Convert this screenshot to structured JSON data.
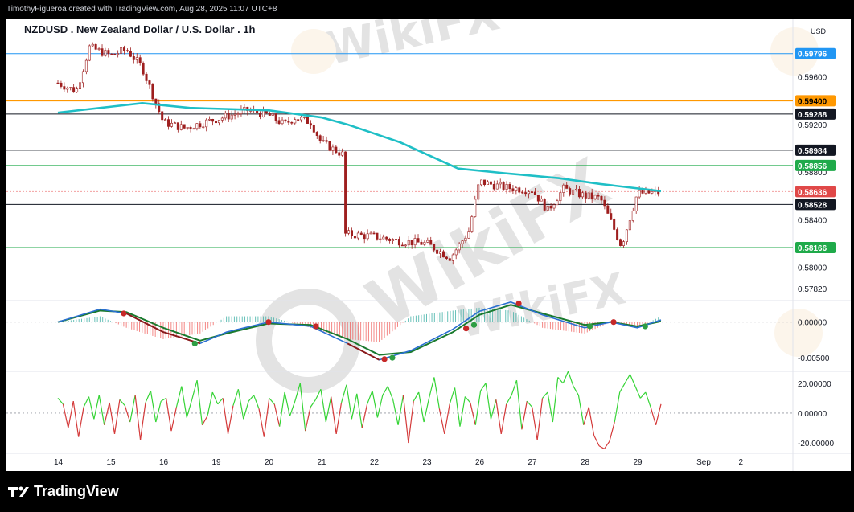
{
  "credit": "TimothyFigueroa created with TradingView.com, Aug 28, 2025 11:07 UTC+8",
  "title": "NZDUSD . New Zealand Dollar / U.S. Dollar . 1h",
  "currency": "USD",
  "brand": "TradingView",
  "watermark": "WikiFX",
  "colors": {
    "candle": "#9e1e1e",
    "ma": "#1fbfc6",
    "macd_line": "#2a6fd1",
    "signal_line": "#1a7a2e",
    "rsi_up": "#36d436",
    "rsi_down": "#d43a3a",
    "blue_level": "#2196f3",
    "orange_level": "#ff9800",
    "green_level": "#1faa4a",
    "red_price": "#e04848"
  },
  "chart_data": [
    {
      "type": "candlestick",
      "name": "NZDUSD 1h",
      "x_labels": [
        "14",
        "15",
        "16",
        "19",
        "20",
        "21",
        "22",
        "23",
        "26",
        "27",
        "28",
        "29",
        "Sep",
        "2"
      ],
      "y_ticks": [
        "0.59600",
        "0.59200",
        "0.58800",
        "0.58400",
        "0.58000",
        "0.57820"
      ],
      "ylim": [
        0.5772,
        0.5999
      ],
      "price_path": [
        {
          "x": 0.0,
          "y": 0.5955
        },
        {
          "x": 0.35,
          "y": 0.5948
        },
        {
          "x": 0.6,
          "y": 0.5985
        },
        {
          "x": 1.0,
          "y": 0.5978
        },
        {
          "x": 1.3,
          "y": 0.5983
        },
        {
          "x": 1.6,
          "y": 0.5968
        },
        {
          "x": 2.0,
          "y": 0.5922
        },
        {
          "x": 2.4,
          "y": 0.5917
        },
        {
          "x": 2.8,
          "y": 0.5922
        },
        {
          "x": 3.3,
          "y": 0.5928
        },
        {
          "x": 3.6,
          "y": 0.5932
        },
        {
          "x": 4.0,
          "y": 0.5928
        },
        {
          "x": 4.3,
          "y": 0.592
        },
        {
          "x": 4.5,
          "y": 0.5926
        },
        {
          "x": 4.8,
          "y": 0.5922
        },
        {
          "x": 5.0,
          "y": 0.5905
        },
        {
          "x": 5.4,
          "y": 0.5895
        },
        {
          "x": 5.45,
          "y": 0.5828
        },
        {
          "x": 6.0,
          "y": 0.5826
        },
        {
          "x": 6.5,
          "y": 0.5822
        },
        {
          "x": 7.0,
          "y": 0.582
        },
        {
          "x": 7.45,
          "y": 0.5808
        },
        {
          "x": 7.8,
          "y": 0.583
        },
        {
          "x": 8.0,
          "y": 0.5872
        },
        {
          "x": 8.5,
          "y": 0.5867
        },
        {
          "x": 9.0,
          "y": 0.5865
        },
        {
          "x": 9.3,
          "y": 0.5848
        },
        {
          "x": 9.6,
          "y": 0.5866
        },
        {
          "x": 10.0,
          "y": 0.586
        },
        {
          "x": 10.3,
          "y": 0.5858
        },
        {
          "x": 10.7,
          "y": 0.5818
        },
        {
          "x": 11.0,
          "y": 0.5862
        },
        {
          "x": 11.45,
          "y": 0.5863
        }
      ],
      "moving_average": [
        {
          "x": 0.0,
          "y": 0.593
        },
        {
          "x": 1.0,
          "y": 0.5935
        },
        {
          "x": 1.6,
          "y": 0.5938
        },
        {
          "x": 2.5,
          "y": 0.5934
        },
        {
          "x": 4.0,
          "y": 0.5932
        },
        {
          "x": 5.0,
          "y": 0.5926
        },
        {
          "x": 5.5,
          "y": 0.592
        },
        {
          "x": 6.5,
          "y": 0.5905
        },
        {
          "x": 7.6,
          "y": 0.5883
        },
        {
          "x": 8.5,
          "y": 0.5879
        },
        {
          "x": 9.5,
          "y": 0.5875
        },
        {
          "x": 10.3,
          "y": 0.587
        },
        {
          "x": 11.45,
          "y": 0.5864
        }
      ],
      "levels": [
        {
          "price": 0.59796,
          "label": "0.59796",
          "style": "blue"
        },
        {
          "price": 0.594,
          "label": "0.59400",
          "style": "orange"
        },
        {
          "price": 0.59288,
          "label": "0.59288",
          "style": "black"
        },
        {
          "price": 0.58984,
          "label": "0.58984",
          "style": "black"
        },
        {
          "price": 0.58856,
          "label": "0.58856",
          "style": "green"
        },
        {
          "price": 0.58636,
          "label": "0.58636",
          "style": "red"
        },
        {
          "price": 0.58528,
          "label": "0.58528",
          "style": "black"
        },
        {
          "price": 0.58166,
          "label": "0.58166",
          "style": "green"
        }
      ]
    },
    {
      "type": "line",
      "name": "MACD",
      "y_ticks": [
        "0.00000",
        "-0.00500"
      ],
      "ylim": [
        -0.0069,
        0.003
      ],
      "macd": [
        {
          "x": 0.0,
          "y": 0.0
        },
        {
          "x": 0.8,
          "y": 0.0018
        },
        {
          "x": 1.3,
          "y": 0.0012
        },
        {
          "x": 2.0,
          "y": -0.0014
        },
        {
          "x": 2.7,
          "y": -0.003
        },
        {
          "x": 3.2,
          "y": -0.0014
        },
        {
          "x": 4.0,
          "y": 0.0
        },
        {
          "x": 4.8,
          "y": -0.0006
        },
        {
          "x": 5.5,
          "y": -0.003
        },
        {
          "x": 6.1,
          "y": -0.0053
        },
        {
          "x": 6.7,
          "y": -0.004
        },
        {
          "x": 7.5,
          "y": -0.001
        },
        {
          "x": 8.0,
          "y": 0.0015
        },
        {
          "x": 8.6,
          "y": 0.0028
        },
        {
          "x": 9.2,
          "y": 0.001
        },
        {
          "x": 10.0,
          "y": -0.0008
        },
        {
          "x": 10.5,
          "y": 0.0
        },
        {
          "x": 11.0,
          "y": -0.0008
        },
        {
          "x": 11.45,
          "y": 0.0003
        }
      ],
      "signal": [
        {
          "x": 0.0,
          "y": 0.0
        },
        {
          "x": 0.8,
          "y": 0.0016
        },
        {
          "x": 1.3,
          "y": 0.0014
        },
        {
          "x": 2.0,
          "y": -0.0008
        },
        {
          "x": 2.7,
          "y": -0.0026
        },
        {
          "x": 3.2,
          "y": -0.0016
        },
        {
          "x": 4.0,
          "y": -0.0002
        },
        {
          "x": 4.8,
          "y": -0.0004
        },
        {
          "x": 5.5,
          "y": -0.0024
        },
        {
          "x": 6.1,
          "y": -0.0046
        },
        {
          "x": 6.7,
          "y": -0.0042
        },
        {
          "x": 7.5,
          "y": -0.0014
        },
        {
          "x": 8.0,
          "y": 0.001
        },
        {
          "x": 8.6,
          "y": 0.0024
        },
        {
          "x": 9.2,
          "y": 0.0012
        },
        {
          "x": 10.0,
          "y": -0.0004
        },
        {
          "x": 10.5,
          "y": 0.0
        },
        {
          "x": 11.0,
          "y": -0.0006
        },
        {
          "x": 11.45,
          "y": 0.0001
        }
      ],
      "cross_markers": [
        {
          "x": 1.25,
          "y": 0.0012,
          "kind": "down"
        },
        {
          "x": 2.6,
          "y": -0.003,
          "kind": "up"
        },
        {
          "x": 4.0,
          "y": 0.0,
          "kind": "down"
        },
        {
          "x": 4.9,
          "y": -0.0006,
          "kind": "down"
        },
        {
          "x": 6.2,
          "y": -0.0052,
          "kind": "down"
        },
        {
          "x": 6.35,
          "y": -0.005,
          "kind": "up"
        },
        {
          "x": 7.75,
          "y": -0.0009,
          "kind": "down"
        },
        {
          "x": 7.9,
          "y": -0.0004,
          "kind": "up"
        },
        {
          "x": 8.75,
          "y": 0.0026,
          "kind": "down"
        },
        {
          "x": 10.1,
          "y": -0.0006,
          "kind": "up"
        },
        {
          "x": 10.55,
          "y": 0.0,
          "kind": "down"
        },
        {
          "x": 11.15,
          "y": -0.0006,
          "kind": "up"
        }
      ]
    },
    {
      "type": "line",
      "name": "Oscillator",
      "y_ticks": [
        "20.00000",
        "0.00000",
        "-20.00000"
      ],
      "ylim": [
        -27,
        28
      ],
      "values": [
        10,
        6,
        -10,
        8,
        -16,
        4,
        11,
        -4,
        12,
        -8,
        7,
        -14,
        9,
        5,
        -6,
        12,
        -18,
        7,
        15,
        -6,
        8,
        10,
        -12,
        4,
        18,
        -3,
        9,
        22,
        -8,
        -2,
        14,
        6,
        10,
        -14,
        5,
        16,
        -4,
        8,
        12,
        3,
        -16,
        10,
        6,
        -9,
        14,
        -2,
        8,
        20,
        -12,
        4,
        9,
        16,
        -6,
        11,
        -14,
        7,
        19,
        -4,
        13,
        -10,
        6,
        15,
        -3,
        12,
        18,
        9,
        -8,
        12,
        -20,
        8,
        14,
        -6,
        10,
        24,
        3,
        -14,
        6,
        17,
        -9,
        11,
        7,
        -8,
        15,
        20,
        -4,
        9,
        -14,
        6,
        12,
        22,
        -11,
        8,
        4,
        -18,
        10,
        14,
        -6,
        24,
        20,
        28,
        18,
        12,
        -8,
        4,
        -15,
        -22,
        -24,
        -19,
        -6,
        14,
        20,
        26,
        18,
        10,
        14,
        4,
        -8,
        6
      ]
    }
  ]
}
